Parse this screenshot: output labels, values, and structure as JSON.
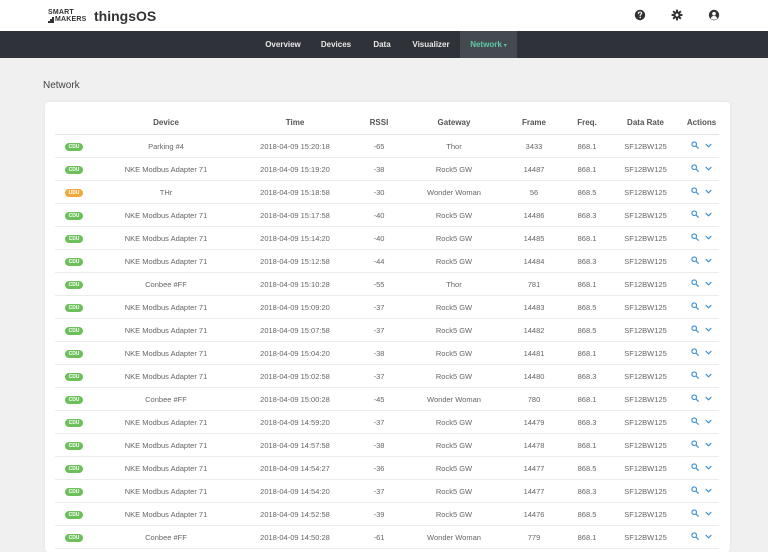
{
  "app": {
    "logo_line1": "SMART",
    "logo_line2": "MAKERS",
    "title": "thingsOS"
  },
  "header_icons": [
    "help-circle-icon",
    "gear-icon",
    "user-circle-icon"
  ],
  "nav": {
    "items": [
      "Overview",
      "Devices",
      "Data",
      "Visualizer",
      "Network"
    ],
    "active": "Network",
    "network_caret": "▾"
  },
  "section_title": "Network",
  "colors": {
    "cdu_badge": "#6cc05a",
    "udu_badge": "#f0a93b",
    "accent": "#5ec9a8",
    "nav_bg": "#2f3339",
    "action_icon": "#3d8fd6"
  },
  "table": {
    "headers": [
      "Device",
      "Time",
      "RSSI",
      "Gateway",
      "Frame",
      "Freq.",
      "Data Rate",
      "Actions"
    ],
    "rows": [
      {
        "type": "CDU",
        "device": "Parking #4",
        "time": "2018-04-09 15:20:18",
        "rssi": "-65",
        "gateway": "Thor",
        "frame": "3433",
        "freq": "868.1",
        "rate": "SF12BW125"
      },
      {
        "type": "CDU",
        "device": "NKE Modbus Adapter 71",
        "time": "2018-04-09 15:19:20",
        "rssi": "-38",
        "gateway": "Rock5 GW",
        "frame": "14487",
        "freq": "868.1",
        "rate": "SF12BW125"
      },
      {
        "type": "UDU",
        "device": "THr",
        "time": "2018-04-09 15:18:58",
        "rssi": "-30",
        "gateway": "Wonder Woman",
        "frame": "56",
        "freq": "868.5",
        "rate": "SF12BW125"
      },
      {
        "type": "CDU",
        "device": "NKE Modbus Adapter 71",
        "time": "2018-04-09 15:17:58",
        "rssi": "-40",
        "gateway": "Rock5 GW",
        "frame": "14486",
        "freq": "868.3",
        "rate": "SF12BW125"
      },
      {
        "type": "CDU",
        "device": "NKE Modbus Adapter 71",
        "time": "2018-04-09 15:14:20",
        "rssi": "-40",
        "gateway": "Rock5 GW",
        "frame": "14485",
        "freq": "868.1",
        "rate": "SF12BW125"
      },
      {
        "type": "CDU",
        "device": "NKE Modbus Adapter 71",
        "time": "2018-04-09 15:12:58",
        "rssi": "-44",
        "gateway": "Rock5 GW",
        "frame": "14484",
        "freq": "868.3",
        "rate": "SF12BW125"
      },
      {
        "type": "CDU",
        "device": "Conbee #FF",
        "time": "2018-04-09 15:10:28",
        "rssi": "-55",
        "gateway": "Thor",
        "frame": "781",
        "freq": "868.1",
        "rate": "SF12BW125"
      },
      {
        "type": "CDU",
        "device": "NKE Modbus Adapter 71",
        "time": "2018-04-09 15:09:20",
        "rssi": "-37",
        "gateway": "Rock5 GW",
        "frame": "14483",
        "freq": "868.5",
        "rate": "SF12BW125"
      },
      {
        "type": "CDU",
        "device": "NKE Modbus Adapter 71",
        "time": "2018-04-09 15:07:58",
        "rssi": "-37",
        "gateway": "Rock5 GW",
        "frame": "14482",
        "freq": "868.5",
        "rate": "SF12BW125"
      },
      {
        "type": "CDU",
        "device": "NKE Modbus Adapter 71",
        "time": "2018-04-09 15:04:20",
        "rssi": "-38",
        "gateway": "Rock5 GW",
        "frame": "14481",
        "freq": "868.1",
        "rate": "SF12BW125"
      },
      {
        "type": "CDU",
        "device": "NKE Modbus Adapter 71",
        "time": "2018-04-09 15:02:58",
        "rssi": "-37",
        "gateway": "Rock5 GW",
        "frame": "14480",
        "freq": "868.3",
        "rate": "SF12BW125"
      },
      {
        "type": "CDU",
        "device": "Conbee #FF",
        "time": "2018-04-09 15:00:28",
        "rssi": "-45",
        "gateway": "Wonder Woman",
        "frame": "780",
        "freq": "868.1",
        "rate": "SF12BW125"
      },
      {
        "type": "CDU",
        "device": "NKE Modbus Adapter 71",
        "time": "2018-04-09 14:59:20",
        "rssi": "-37",
        "gateway": "Rock5 GW",
        "frame": "14479",
        "freq": "868.3",
        "rate": "SF12BW125"
      },
      {
        "type": "CDU",
        "device": "NKE Modbus Adapter 71",
        "time": "2018-04-09 14:57:58",
        "rssi": "-38",
        "gateway": "Rock5 GW",
        "frame": "14478",
        "freq": "868.1",
        "rate": "SF12BW125"
      },
      {
        "type": "CDU",
        "device": "NKE Modbus Adapter 71",
        "time": "2018-04-09 14:54:27",
        "rssi": "-36",
        "gateway": "Rock5 GW",
        "frame": "14477",
        "freq": "868.5",
        "rate": "SF12BW125"
      },
      {
        "type": "CDU",
        "device": "NKE Modbus Adapter 71",
        "time": "2018-04-09 14:54:20",
        "rssi": "-37",
        "gateway": "Rock5 GW",
        "frame": "14477",
        "freq": "868.3",
        "rate": "SF12BW125"
      },
      {
        "type": "CDU",
        "device": "NKE Modbus Adapter 71",
        "time": "2018-04-09 14:52:58",
        "rssi": "-39",
        "gateway": "Rock5 GW",
        "frame": "14476",
        "freq": "868.5",
        "rate": "SF12BW125"
      },
      {
        "type": "CDU",
        "device": "Conbee #FF",
        "time": "2018-04-09 14:50:28",
        "rssi": "-61",
        "gateway": "Wonder Woman",
        "frame": "779",
        "freq": "868.1",
        "rate": "SF12BW125"
      }
    ]
  }
}
